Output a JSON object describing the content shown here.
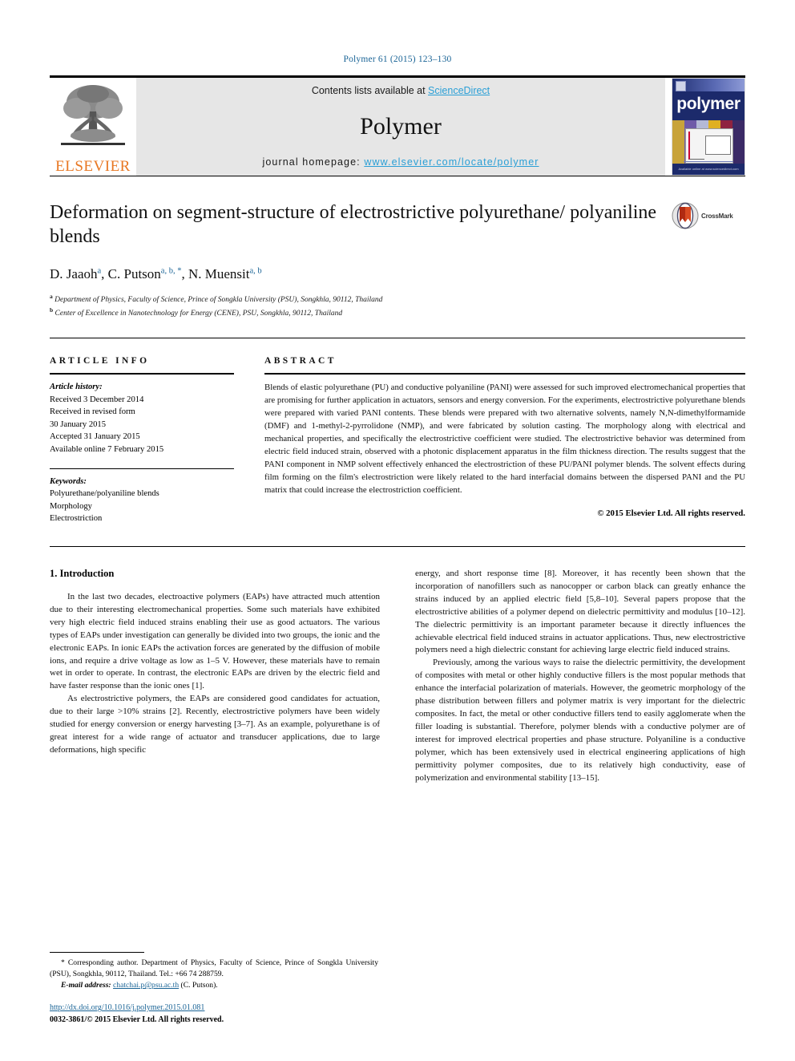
{
  "running_head": "Polymer 61 (2015) 123–130",
  "masthead": {
    "publisher_name": "ELSEVIER",
    "contents_prefix": "Contents lists available at ",
    "contents_link": "ScienceDirect",
    "journal_title": "Polymer",
    "homepage_prefix": "journal homepage: ",
    "homepage_url": "www.elsevier.com/locate/polymer",
    "cover_word": "polymer",
    "cover_footer": "Available online at www.sciencedirect.com"
  },
  "article": {
    "title": "Deformation on segment-structure of electrostrictive polyurethane/ polyaniline blends",
    "authors": "D. Jaaoh , C. Putson , N. Muensit",
    "author_list": [
      {
        "name": "D. Jaaoh",
        "marks": "a"
      },
      {
        "name": "C. Putson",
        "marks": "a, b, *"
      },
      {
        "name": "N. Muensit",
        "marks": "a, b"
      }
    ],
    "affiliations": [
      {
        "mark": "a",
        "text": "Department of Physics, Faculty of Science, Prince of Songkla University (PSU), Songkhla, 90112, Thailand"
      },
      {
        "mark": "b",
        "text": "Center of Excellence in Nanotechnology for Energy (CENE), PSU, Songkhla, 90112, Thailand"
      }
    ],
    "crossmark_label": "CrossMark"
  },
  "article_info": {
    "heading": "ARTICLE INFO",
    "history_label": "Article history:",
    "history_lines": [
      "Received 3 December 2014",
      "Received in revised form",
      "30 January 2015",
      "Accepted 31 January 2015",
      "Available online 7 February 2015"
    ],
    "keywords_label": "Keywords:",
    "keywords": [
      "Polyurethane/polyaniline blends",
      "Morphology",
      "Electrostriction"
    ]
  },
  "abstract": {
    "heading": "ABSTRACT",
    "text": "Blends of elastic polyurethane (PU) and conductive polyaniline (PANI) were assessed for such improved electromechanical properties that are promising for further application in actuators, sensors and energy conversion. For the experiments, electrostrictive polyurethane blends were prepared with varied PANI contents. These blends were prepared with two alternative solvents, namely N,N-dimethylformamide (DMF) and 1-methyl-2-pyrrolidone (NMP), and were fabricated by solution casting. The morphology along with electrical and mechanical properties, and specifically the electrostrictive coefficient were studied. The electrostrictive behavior was determined from electric field induced strain, observed with a photonic displacement apparatus in the film thickness direction. The results suggest that the PANI component in NMP solvent effectively enhanced the electrostriction of these PU/PANI polymer blends. The solvent effects during film forming on the film's electrostriction were likely related to the hard interfacial domains between the dispersed PANI and the PU matrix that could increase the electrostriction coefficient.",
    "copyright": "© 2015 Elsevier Ltd. All rights reserved."
  },
  "introduction": {
    "section_number_title": "1. Introduction",
    "left_paragraphs": [
      "In the last two decades, electroactive polymers (EAPs) have attracted much attention due to their interesting electromechanical properties. Some such materials have exhibited very high electric field induced strains enabling their use as good actuators. The various types of EAPs under investigation can generally be divided into two groups, the ionic and the electronic EAPs. In ionic EAPs the activation forces are generated by the diffusion of mobile ions, and require a drive voltage as low as 1–5 V. However, these materials have to remain wet in order to operate. In contrast, the electronic EAPs are driven by the electric field and have faster response than the ionic ones [1].",
      "As electrostrictive polymers, the EAPs are considered good candidates for actuation, due to their large >10% strains [2]. Recently, electrostrictive polymers have been widely studied for energy conversion or energy harvesting [3–7]. As an example, polyurethane is of great interest for a wide range of actuator and transducer applications, due to large deformations, high specific"
    ],
    "right_paragraphs": [
      "energy, and short response time [8]. Moreover, it has recently been shown that the incorporation of nanofillers such as nanocopper or carbon black can greatly enhance the strains induced by an applied electric field [5,8–10]. Several papers propose that the electrostrictive abilities of a polymer depend on dielectric permittivity and modulus [10–12]. The dielectric permittivity is an important parameter because it directly influences the achievable electrical field induced strains in actuator applications. Thus, new electrostrictive polymers need a high dielectric constant for achieving large electric field induced strains.",
      "Previously, among the various ways to raise the dielectric permittivity, the development of composites with metal or other highly conductive fillers is the most popular methods that enhance the interfacial polarization of materials. However, the geometric morphology of the phase distribution between fillers and polymer matrix is very important for the dielectric composites. In fact, the metal or other conductive fillers tend to easily agglomerate when the filler loading is substantial. Therefore, polymer blends with a conductive polymer are of interest for improved electrical properties and phase structure. Polyaniline is a conductive polymer, which has been extensively used in electrical engineering applications of high permittivity polymer composites, due to its relatively high conductivity, ease of polymerization and environmental stability [13–15]."
    ],
    "inline_refs_left": [
      "[1]",
      "[2]",
      "[3–7]"
    ],
    "inline_refs_right": [
      "[8]",
      "[5,8–10]",
      "[10–12]",
      "[13–15]"
    ]
  },
  "footnote": {
    "corresponding": "* Corresponding author. Department of Physics, Faculty of Science, Prince of Songkla University (PSU), Songkhla, 90112, Thailand. Tel.: +66 74 288759.",
    "email_label": "E-mail address:",
    "email": "chatchai.p@psu.ac.th",
    "email_suffix": "(C. Putson).",
    "doi": "http://dx.doi.org/10.1016/j.polymer.2015.01.081",
    "issn_line": "0032-3861/© 2015 Elsevier Ltd. All rights reserved."
  },
  "colors": {
    "link_blue": "#1a6496",
    "sciencedirect_blue": "#2a9fd6",
    "elsevier_orange": "#e87722",
    "masthead_grey": "#e6e6e6",
    "cover_navy": "#1c2a6b"
  }
}
